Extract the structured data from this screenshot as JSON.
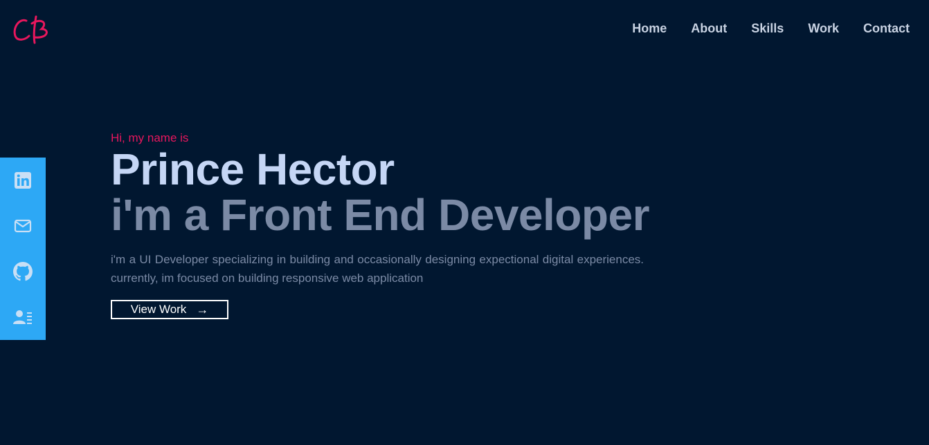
{
  "logo": {
    "text": "CB",
    "color": "#e8175d"
  },
  "nav": {
    "items": [
      {
        "label": "Home"
      },
      {
        "label": "About"
      },
      {
        "label": "Skills"
      },
      {
        "label": "Work"
      },
      {
        "label": "Contact"
      }
    ]
  },
  "social": {
    "background": "#2da8f5",
    "icons": [
      "linkedin-icon",
      "email-icon",
      "github-icon",
      "resume-icon"
    ]
  },
  "hero": {
    "greeting": "Hi, my name is",
    "name": "Prince Hector",
    "role": "i'm a Front End Developer",
    "description": "i'm a UI Developer specializing in building and occasionally designing expectional digital experiences. currently, im focused on building responsive web application",
    "cta_label": "View Work",
    "cta_arrow": "→"
  },
  "colors": {
    "background": "#011730",
    "accent": "#e8175d",
    "name": "#c5d6f5",
    "muted": "#7b8aa5"
  }
}
